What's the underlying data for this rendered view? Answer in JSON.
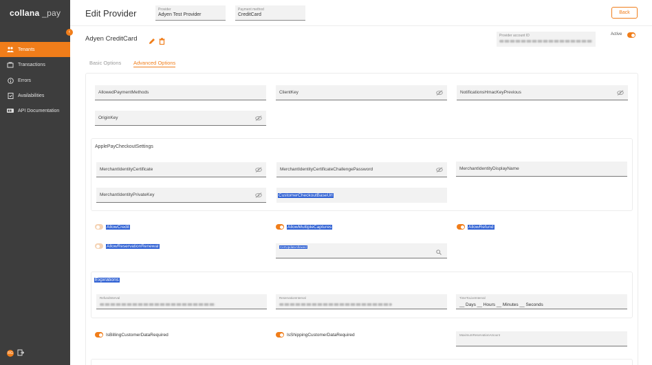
{
  "app": {
    "logo_bold": "collana",
    "logo_light": "pay",
    "collapse_icon": "chevron-left"
  },
  "sidebar": {
    "items": [
      {
        "label": "Tenants",
        "icon": "people-icon",
        "active": true
      },
      {
        "label": "Transactions",
        "icon": "cart-icon",
        "active": false
      },
      {
        "label": "Errors",
        "icon": "info-icon",
        "active": false
      },
      {
        "label": "Availabilities",
        "icon": "clipboard-icon",
        "active": false
      },
      {
        "label": "API Documentation",
        "icon": "api-icon",
        "active": false
      }
    ],
    "user_initials": "RG"
  },
  "header": {
    "title": "Edit Provider",
    "provider_label": "Provider",
    "provider_value": "Adyen Test Provider",
    "payment_method_label": "Payment method",
    "payment_method_value": "CreditCard",
    "back_label": "Back"
  },
  "card": {
    "title": "Adyen CreditCard",
    "account_id_label": "Provider account ID",
    "active_label": "Active",
    "active_on": true
  },
  "tabs": [
    {
      "label": "Basic Options",
      "selected": false
    },
    {
      "label": "Advanced Options",
      "selected": true
    }
  ],
  "fields": {
    "allowed_payment_methods": "AllowedPaymentMethods",
    "client_key": "ClientKey",
    "notifications_hmac_key_previous": "NotificationsHmacKeyPrevious",
    "origin_key": "OriginKey"
  },
  "apple_pay": {
    "title": "ApplePayCheckoutSettings",
    "merchant_identity_certificate": "MerchantIdentityCertificate",
    "merchant_identity_certificate_challenge_password": "MerchantIdentityCertificateChallengePassword",
    "merchant_identity_display_name": "MerchantIdentityDisplayName",
    "merchant_identity_private_key": "MerchantIdentityPrivateKey",
    "customer_checkout_base_url": "CustomerCheckoutBaseUrl"
  },
  "toggles": {
    "allow_credit": {
      "label": "AllowCredit",
      "on": false
    },
    "allow_multiple_captures": {
      "label": "AllowMultipleCaptures",
      "on": true
    },
    "allow_refund": {
      "label": "AllowRefund",
      "on": true
    },
    "allow_reservation_renewal": {
      "label": "AllowReservationRenewal",
      "on": false
    },
    "is_billing_customer_data_required": {
      "label": "IsBillingCustomerDataRequired",
      "on": true
    },
    "is_shipping_customer_data_required": {
      "label": "IsShippingCustomerDataRequired",
      "on": true
    }
  },
  "capture_mode": {
    "label": "CertUpdateAllowed"
  },
  "expirations": {
    "title": "Expirations",
    "refund_interval_label": "RefundInterval",
    "reservation_interval_label": "ReservationInterval",
    "time_to_live_label": "TimeToLiveInterval",
    "time_to_live_value": "__ Days __ Hours __ Minutes __ Seconds"
  },
  "maximum_reservation_amount_label": "MaximumReservationAmount",
  "colors": {
    "accent": "#f07d1a",
    "sidebar_bg": "#3d3d3d",
    "selection": "#2d5fd3"
  }
}
